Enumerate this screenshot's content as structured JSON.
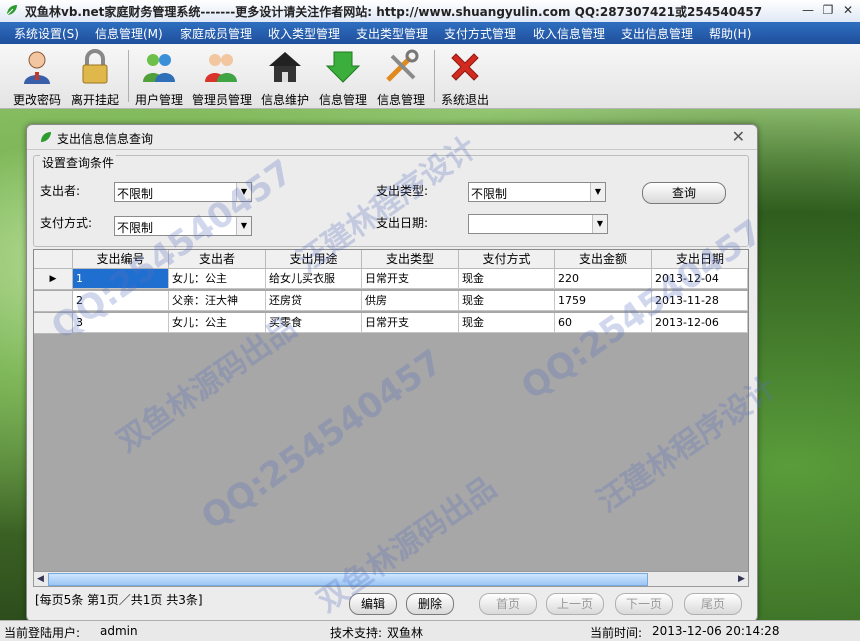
{
  "window": {
    "title": "双鱼林vb.net家庭财务管理系统-------更多设计请关注作者网站:   http://www.shuangyulin.com   QQ:287307421或254540457"
  },
  "menu": [
    "系统设置(S)",
    "信息管理(M)",
    "家庭成员管理",
    "收入类型管理",
    "支出类型管理",
    "支付方式管理",
    "收入信息管理",
    "支出信息管理",
    "帮助(H)"
  ],
  "toolbar": [
    {
      "label": "更改密码",
      "icon": "user-key-icon"
    },
    {
      "label": "离开挂起",
      "icon": "lock-icon"
    },
    {
      "label": "用户管理",
      "icon": "users-icon"
    },
    {
      "label": "管理员管理",
      "icon": "admins-icon"
    },
    {
      "label": "信息维护",
      "icon": "house-icon"
    },
    {
      "label": "信息管理",
      "icon": "green-arrow-icon"
    },
    {
      "label": "信息管理",
      "icon": "tools-icon"
    },
    {
      "label": "系统退出",
      "icon": "exit-x-icon"
    }
  ],
  "dialog": {
    "title": "支出信息信息查询",
    "group_title": "设置查询条件",
    "filters": {
      "spender_label": "支出者:",
      "spender_value": "不限制",
      "pay_type_label": "支付方式:",
      "pay_type_value": "不限制",
      "expense_type_label": "支出类型:",
      "expense_type_value": "不限制",
      "date_label": "支出日期:",
      "date_value": ""
    },
    "query_button": "查询",
    "columns": [
      "支出编号",
      "支出者",
      "支出用途",
      "支出类型",
      "支付方式",
      "支出金额",
      "支出日期"
    ],
    "rows": [
      [
        "1",
        "女儿：公主",
        "给女儿买衣服",
        "日常开支",
        "现金",
        "220",
        "2013-12-04"
      ],
      [
        "2",
        "父亲：汪大神",
        "还房贷",
        "供房",
        "现金",
        "1759",
        "2013-11-28"
      ],
      [
        "3",
        "女儿：公主",
        "买零食",
        "日常开支",
        "现金",
        "60",
        "2013-12-06"
      ]
    ],
    "current_row_marker": "▶",
    "page_info": "[每页5条 第1页／共1页    共3条]",
    "buttons": {
      "edit": "编辑",
      "delete": "删除",
      "first": "首页",
      "prev": "上一页",
      "next": "下一页",
      "last": "尾页"
    }
  },
  "status": {
    "user_label": "当前登陆用户:",
    "user": "admin",
    "support_label": "技术支持:",
    "support": "双鱼林",
    "time_label": "当前时间:",
    "time": "2013-12-06 20:14:28"
  },
  "watermarks": [
    "QQ:254540457",
    "双鱼林源码出品",
    "汪建林程序设计"
  ],
  "colors": {
    "menu_bg": "#1f4f9c",
    "selection": "#1f6fd1",
    "watermark": "#5a6ebe"
  }
}
